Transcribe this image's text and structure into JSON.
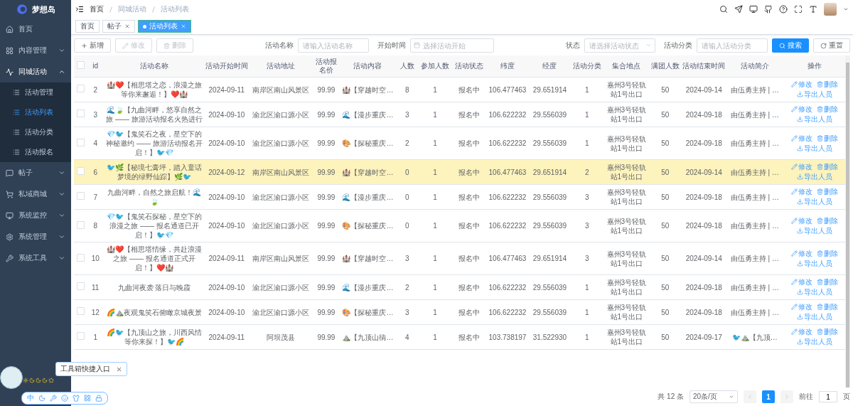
{
  "sidebar": {
    "logo": "梦想岛",
    "items": [
      {
        "label": "首页",
        "kind": "home",
        "expanded": false,
        "has_children": false
      },
      {
        "label": "内容管理",
        "kind": "grid",
        "expanded": false,
        "has_children": true
      },
      {
        "label": "同城活动",
        "kind": "activity",
        "expanded": true,
        "has_children": true,
        "children": [
          {
            "label": "活动管理",
            "selected": false
          },
          {
            "label": "活动列表",
            "selected": true
          },
          {
            "label": "活动分类",
            "selected": false
          },
          {
            "label": "活动报名",
            "selected": false
          }
        ]
      },
      {
        "label": "帖子",
        "kind": "post",
        "expanded": false,
        "has_children": true
      },
      {
        "label": "私域商城",
        "kind": "cart",
        "expanded": false,
        "has_children": true
      },
      {
        "label": "系统监控",
        "kind": "monitor",
        "expanded": false,
        "has_children": true
      },
      {
        "label": "系统管理",
        "kind": "settings",
        "expanded": false,
        "has_children": true
      },
      {
        "label": "系统工具",
        "kind": "tool",
        "expanded": false,
        "has_children": true
      }
    ]
  },
  "breadcrumb": [
    "首页",
    "同城活动",
    "活动列表"
  ],
  "tags": [
    {
      "label": "首页",
      "selected": false,
      "closable": false
    },
    {
      "label": "帖子",
      "selected": false,
      "closable": true
    },
    {
      "label": "活动列表",
      "selected": true,
      "closable": true
    }
  ],
  "toolbar": [
    {
      "kind": "add",
      "label": "新增",
      "disabled": false
    },
    {
      "kind": "edit",
      "label": "修改",
      "disabled": true
    },
    {
      "kind": "delete",
      "label": "删除",
      "disabled": true
    }
  ],
  "filters": [
    {
      "label": "活动名称",
      "kind": "text",
      "placeholder": "请输入活动名称"
    },
    {
      "label": "开始时间",
      "kind": "date",
      "placeholder": "选择活动开始"
    },
    {
      "label": "状态",
      "kind": "select",
      "placeholder": "请选择活动状态"
    },
    {
      "label": "活动分类",
      "kind": "text",
      "placeholder": "请输入活动分类"
    }
  ],
  "search_button": "搜索",
  "reset_button": "重置",
  "table": {
    "header_checked": false,
    "columns": [
      "id",
      "活动名称",
      "活动开始时间",
      "活动地址",
      "活动报名价",
      "活动内容",
      "人数",
      "参加人数",
      "活动状态",
      "纬度",
      "经度",
      "活动分类",
      "集合地点",
      "满团人数",
      "活动结束时间",
      "活动简介",
      "操作"
    ],
    "rows": [
      {
        "checked": false,
        "highlighted": false,
        "cells": [
          "2",
          "🏰❤️【相思塔之恋，浪漫之旅等你来邂逅！】❤️🏰",
          "2024-09-11",
          "南岸区南山风景区",
          "99.99",
          "🏰【穿越时空…",
          "8",
          "1",
          "报名中",
          "106.477463",
          "29.651914",
          "1",
          "嘉州3号轻轨站1号出口",
          "50",
          "2024-09-14",
          "由伍勇主持 | …"
        ],
        "actions": [
          {
            "kind": "edit",
            "label": "修改"
          },
          {
            "kind": "delete",
            "label": "删除"
          },
          {
            "kind": "export",
            "label": "导出人员"
          }
        ]
      },
      {
        "checked": false,
        "highlighted": false,
        "cells": [
          "3",
          "🌊🍃【九曲河畔，悠享自然之旅 —— 旅游活动报名火热进行",
          "2024-09-10",
          "渝北区渝口源小区",
          "99.99",
          "🌊【漫步重庆…",
          "3",
          "1",
          "报名中",
          "106.622232",
          "29.556039",
          "1",
          "嘉州3号轻轨站1号出口",
          "50",
          "2024-09-18",
          "由伍勇主持 | …"
        ],
        "actions": [
          {
            "kind": "edit",
            "label": "修改"
          },
          {
            "kind": "delete",
            "label": "删除"
          },
          {
            "kind": "export",
            "label": "导出人员"
          }
        ]
      },
      {
        "checked": false,
        "highlighted": false,
        "cells": [
          "4",
          "💎🐦【鬼笑石之夜，星空下的神秘邀约 —— 旅游活动报名开启！】🐦💎",
          "2024-09-10",
          "渝北区渝口源小区",
          "99.99",
          "🎨【探秘重庆…",
          "2",
          "1",
          "报名中",
          "106.622232",
          "29.556039",
          "1",
          "嘉州3号轻轨站1号出口",
          "50",
          "2024-09-18",
          "由伍勇主持 | …"
        ],
        "actions": [
          {
            "kind": "edit",
            "label": "修改"
          },
          {
            "kind": "delete",
            "label": "删除"
          },
          {
            "kind": "export",
            "label": "导出人员"
          }
        ]
      },
      {
        "checked": false,
        "highlighted": true,
        "cells": [
          "6",
          "🐦🌿【秘境七膏坪，踏入童话梦境的绿野仙踪】🌿🐦",
          "2024-09-12",
          "南岸区南山风景区",
          "99.99",
          "🏰【穿越时空…",
          "0",
          "1",
          "报名中",
          "106.477463",
          "29.651914",
          "2",
          "嘉州3号轻轨站1号出口",
          "50",
          "2024-09-14",
          "由伍勇主持 | …"
        ],
        "actions": [
          {
            "kind": "edit",
            "label": "修改"
          },
          {
            "kind": "delete",
            "label": "删除"
          },
          {
            "kind": "export",
            "label": "导出人员"
          }
        ]
      },
      {
        "checked": false,
        "highlighted": false,
        "cells": [
          "7",
          "九曲河畔，自然之旅启航！🌊🍃",
          "2024-09-10",
          "渝北区渝口源小区",
          "99.99",
          "🌊【漫步重庆…",
          "0",
          "1",
          "报名中",
          "106.622232",
          "29.556039",
          "3",
          "嘉州3号轻轨站1号出口",
          "50",
          "2024-09-18",
          "由伍勇主持 | …"
        ],
        "actions": [
          {
            "kind": "edit",
            "label": "修改"
          },
          {
            "kind": "delete",
            "label": "删除"
          },
          {
            "kind": "export",
            "label": "导出人员"
          }
        ]
      },
      {
        "checked": false,
        "highlighted": false,
        "cells": [
          "8",
          "💎🐦【鬼笑石探秘，星空下的浪漫之旅 —— 报名通道已开启！】🐦💎",
          "2024-09-10",
          "渝北区渝口源小区",
          "99.99",
          "🎨【探秘重庆…",
          "0",
          "1",
          "报名中",
          "106.622232",
          "29.556039",
          "3",
          "嘉州3号轻轨站1号出口",
          "50",
          "2024-09-18",
          "由伍勇主持 | …"
        ],
        "actions": [
          {
            "kind": "edit",
            "label": "修改"
          },
          {
            "kind": "delete",
            "label": "删除"
          },
          {
            "kind": "export",
            "label": "导出人员"
          }
        ]
      },
      {
        "checked": false,
        "highlighted": false,
        "cells": [
          "10",
          "🏰❤️【相思塔情缘，共赴浪漫之旅 —— 报名通道正式开启！】❤️🏰",
          "2024-09-11",
          "南岸区南山风景区",
          "99.99",
          "🏰【穿越时空…",
          "3",
          "1",
          "报名中",
          "106.477463",
          "29.651914",
          "3",
          "嘉州3号轻轨站1号出口",
          "50",
          "2024-09-14",
          "由伍勇主持 | …"
        ],
        "actions": [
          {
            "kind": "edit",
            "label": "修改"
          },
          {
            "kind": "delete",
            "label": "删除"
          },
          {
            "kind": "export",
            "label": "导出人员"
          }
        ]
      },
      {
        "checked": false,
        "highlighted": false,
        "cells": [
          "11",
          "九曲河夜袭 落日与晚霞",
          "2024-09-10",
          "渝北区渝口源小区",
          "99.99",
          "🌊【漫步重庆…",
          "2",
          "1",
          "报名中",
          "106.622232",
          "29.556039",
          "1",
          "嘉州3号轻轨站1号出口",
          "50",
          "2024-09-18",
          "由伍勇主持 | …"
        ],
        "actions": [
          {
            "kind": "edit",
            "label": "修改"
          },
          {
            "kind": "delete",
            "label": "删除"
          },
          {
            "kind": "export",
            "label": "导出人员"
          }
        ]
      },
      {
        "checked": false,
        "highlighted": false,
        "cells": [
          "12",
          "🌈⛰️夜观鬼笑石俯瞰京城夜景",
          "2024-09-10",
          "渝北区渝口源小区",
          "99.99",
          "🎨【探秘重庆…",
          "3",
          "1",
          "报名中",
          "106.622232",
          "29.556039",
          "1",
          "嘉州3号轻轨站1号出口",
          "50",
          "2024-09-18",
          "由伍勇主持 | …"
        ],
        "actions": [
          {
            "kind": "edit",
            "label": "修改"
          },
          {
            "kind": "delete",
            "label": "删除"
          },
          {
            "kind": "export",
            "label": "导出人员"
          }
        ]
      },
      {
        "checked": false,
        "highlighted": false,
        "cells": [
          "1",
          "🌈🐦【九顶山之旅，川西风情等你来探！】🐦🌈",
          "2024-09-11",
          "阿坝茂县",
          "99.99",
          "⛰️【九顶山徜…",
          "4",
          "1",
          "报名中",
          "103.738197",
          "31.522930",
          "1",
          "嘉州3号轻轨站1号出口",
          "50",
          "2024-09-17",
          "🐦⛰️【九顶…"
        ],
        "actions": [
          {
            "kind": "edit",
            "label": "修改"
          },
          {
            "kind": "delete",
            "label": "删除"
          },
          {
            "kind": "export",
            "label": "导出人员"
          }
        ]
      }
    ]
  },
  "pagination": {
    "total": "共 12 条",
    "page_size": "20条/页",
    "pages": [
      {
        "label": "1",
        "selected": true
      }
    ],
    "goto_label": "前往",
    "goto_value": "1",
    "goto_suffix": "页"
  },
  "toolbox": {
    "tooltip": "工具箱快捷入口",
    "lang": "中"
  }
}
